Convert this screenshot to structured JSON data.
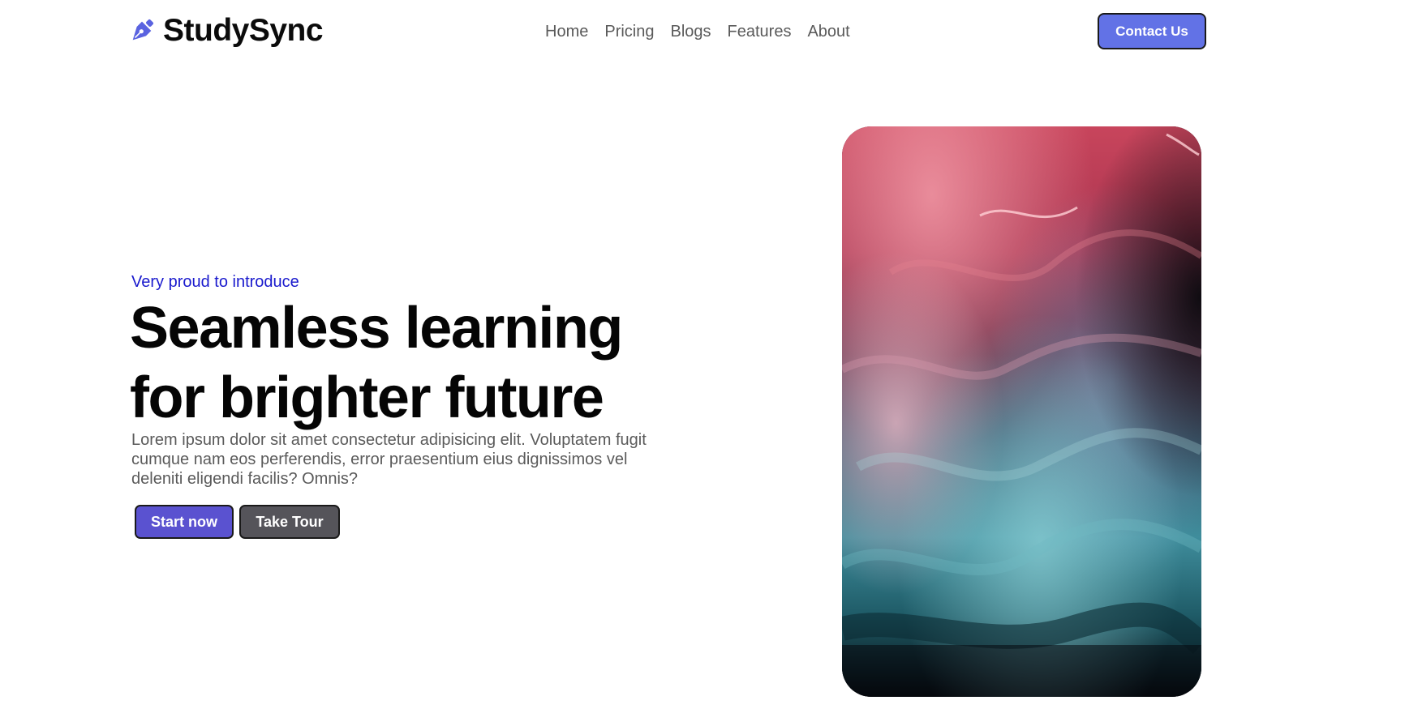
{
  "brand": {
    "name": "StudySync",
    "logo_icon": "pen-nib-icon",
    "accent_color": "#5a63e0"
  },
  "nav": {
    "items": [
      {
        "label": "Home"
      },
      {
        "label": "Pricing"
      },
      {
        "label": "Blogs"
      },
      {
        "label": "Features"
      },
      {
        "label": "About"
      }
    ]
  },
  "header": {
    "contact_label": "Contact Us",
    "contact_color": "#6272e6"
  },
  "hero": {
    "eyebrow": "Very proud to introduce",
    "headline_line1": "Seamless learning",
    "headline_line2": "for brighter future",
    "description": "Lorem ipsum dolor sit amet consectetur adipisicing elit. Voluptatem fugit cumque nam eos perferendis, error praesentium eius dignissimos vel deleniti eligendi facilis? Omnis?",
    "primary_cta": "Start now",
    "secondary_cta": "Take Tour",
    "primary_color": "#5a52d0",
    "secondary_color": "#55545a",
    "image": "abstract-fluid-art-image"
  }
}
